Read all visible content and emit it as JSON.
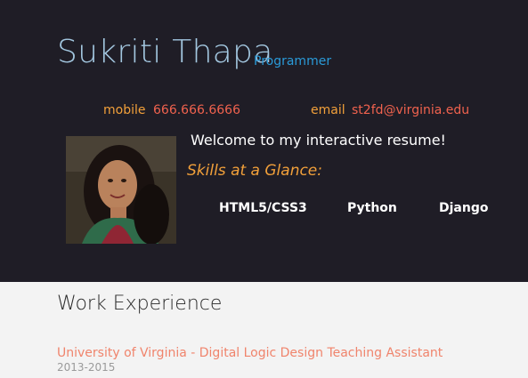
{
  "header": {
    "name": "Sukriti Thapa",
    "role": "Programmer",
    "contacts": [
      {
        "label": "mobile",
        "value": "666.666.6666"
      },
      {
        "label": "email",
        "value": "st2fd@virginia.edu"
      }
    ],
    "welcome": "Welcome to my interactive resume!",
    "skills_title": "Skills at a Glance:",
    "skills": [
      "HTML5/CSS3",
      "Python",
      "Django"
    ]
  },
  "work": {
    "section_title": "Work Experience",
    "jobs": [
      {
        "title": "University of Virginia - Digital Logic Design Teaching Assistant",
        "dates": "2013-2015"
      }
    ]
  },
  "colors": {
    "header_bg": "#1f1d26",
    "name": "#a3c7e0",
    "role": "#2a9ad8",
    "label_accent": "#f2a03a",
    "value_accent": "#f0624e",
    "job_title": "#f0846c"
  }
}
